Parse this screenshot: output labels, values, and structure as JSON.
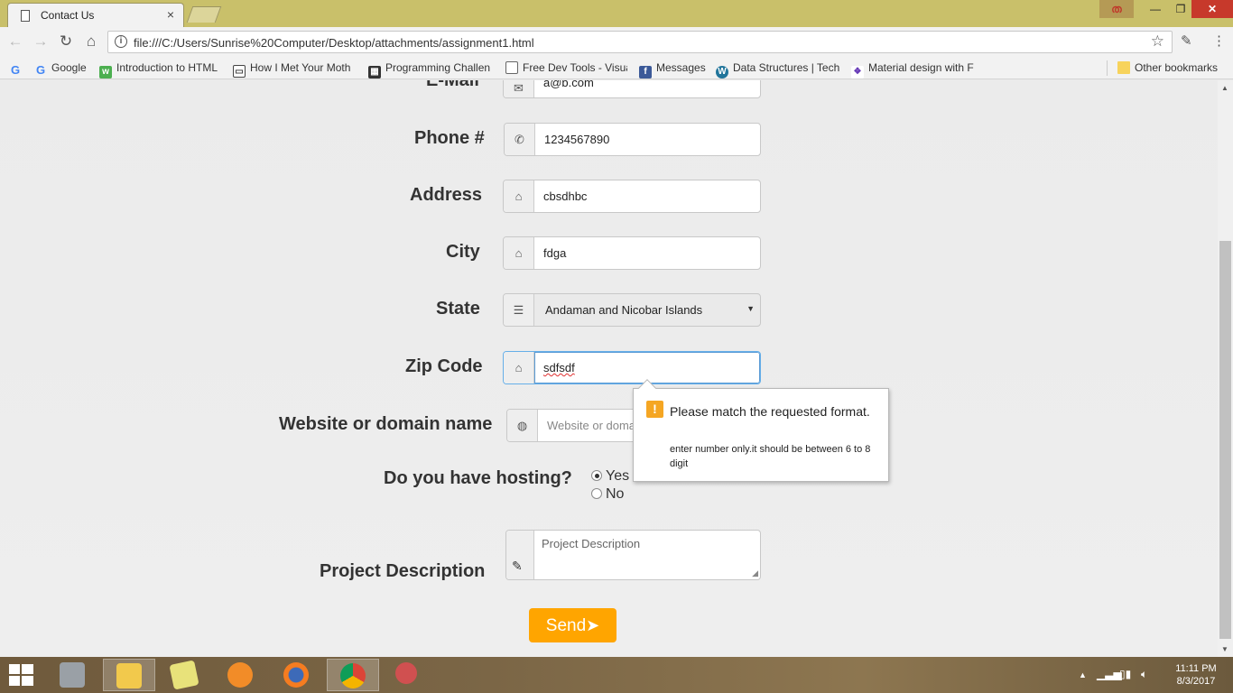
{
  "browser": {
    "tab_title": "Contact Us",
    "tab_close": "×",
    "url": "file:///C:/Users/Sunrise%20Computer/Desktop/attachments/assignment1.html",
    "bookmarks": [
      {
        "label": "Google",
        "icon": "google-icon"
      },
      {
        "label": "Introduction to HTML",
        "icon": "w3schools-icon"
      },
      {
        "label": "How I Met Your Moth",
        "icon": "tv-icon"
      },
      {
        "label": "Programming Challen",
        "icon": "grid-icon"
      },
      {
        "label": "Free Dev Tools - Visua",
        "icon": "page-icon"
      },
      {
        "label": "Messages",
        "icon": "facebook-icon"
      },
      {
        "label": "Data Structures | Tech",
        "icon": "wordpress-icon"
      },
      {
        "label": "Material design with F",
        "icon": "material-icon"
      }
    ],
    "other_bookmarks": "Other bookmarks"
  },
  "form": {
    "email": {
      "label": "E-Mail",
      "value": "a@b.com"
    },
    "phone": {
      "label": "Phone #",
      "value": "1234567890"
    },
    "address": {
      "label": "Address",
      "value": "cbsdhbc"
    },
    "city": {
      "label": "City",
      "value": "fdga"
    },
    "state": {
      "label": "State",
      "value": "Andaman and Nicobar Islands"
    },
    "zip": {
      "label": "Zip Code",
      "value": "sdfsdf"
    },
    "website": {
      "label": "Website or domain name",
      "placeholder": "Website or doma"
    },
    "hosting": {
      "label": "Do you have hosting?",
      "options": [
        "Yes",
        "No"
      ],
      "selected": "Yes"
    },
    "description": {
      "label": "Project Description",
      "placeholder": "Project Description"
    },
    "send_label": "Send"
  },
  "validation": {
    "title": "Please match the requested format.",
    "message": "enter number only.it should be between 6 to 8 digit"
  },
  "taskbar": {
    "time": "11:11 PM",
    "date": "8/3/2017"
  },
  "colors": {
    "accent_send": "#ffa500",
    "focus_border": "#5b9bd5",
    "warning": "#f5a623"
  }
}
